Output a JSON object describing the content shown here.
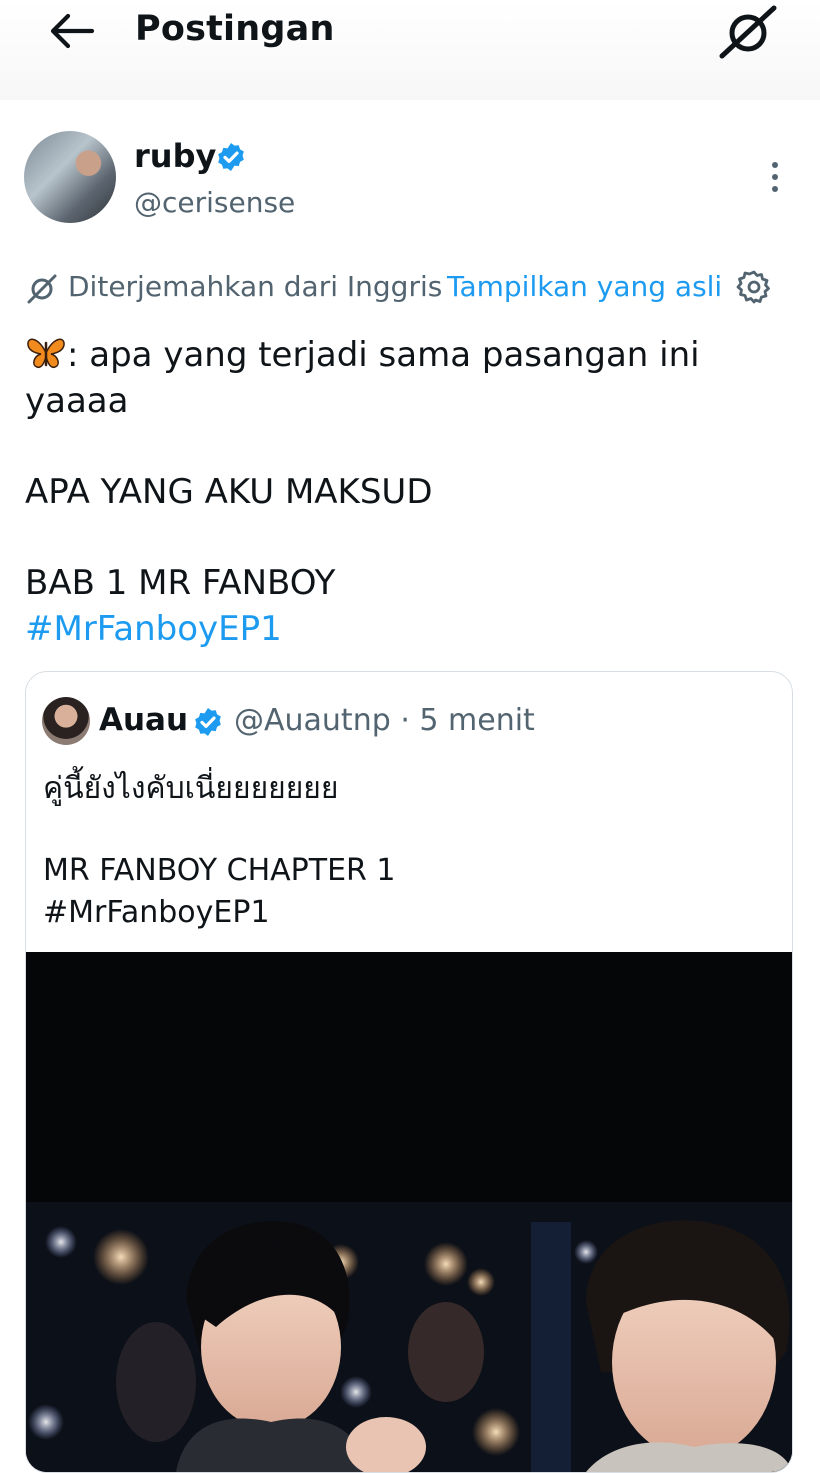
{
  "header": {
    "title": "Postingan"
  },
  "tweet": {
    "author": {
      "display_name": "ruby",
      "handle": "@cerisense",
      "verified": true
    },
    "translation": {
      "notice": "Diterjemahkan dari Inggris",
      "show_original": "Tampilkan yang asli"
    },
    "text": {
      "line1": ": apa yang terjadi sama pasangan ini yaaaa",
      "line2": "APA YANG AKU MAKSUD",
      "line3": "BAB 1 MR FANBOY",
      "hashtag": "#MrFanboyEP1"
    }
  },
  "quoted_tweet": {
    "author": {
      "display_name": "Auau",
      "handle": "@Auautnp",
      "verified": true
    },
    "time": "5 menit",
    "text": {
      "line1": "คู่นี้ยังไงคับเนี่ยยยยยยย",
      "line2": "MR FANBOY CHAPTER 1",
      "line3": "#MrFanboyEP1"
    },
    "media": {
      "type": "photo",
      "description_icon": "photo"
    }
  },
  "colors": {
    "accent": "#1d9bf0",
    "secondary_text": "#536471",
    "primary_text": "#0f1419"
  }
}
